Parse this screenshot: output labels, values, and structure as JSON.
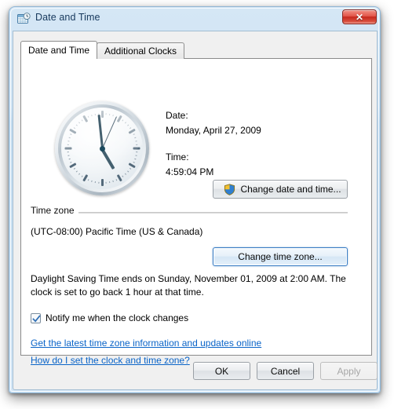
{
  "window": {
    "title": "Date and Time",
    "icon": "date-time-icon",
    "close_label": "✕"
  },
  "tabs": [
    {
      "label": "Date and Time",
      "active": true
    },
    {
      "label": "Additional Clocks",
      "active": false
    }
  ],
  "main": {
    "clock": {
      "icon": "analog-clock",
      "hour_angle": 149.5,
      "minute_angle": 354,
      "second_angle": 24
    },
    "date_label": "Date:",
    "date_value": "Monday, April 27, 2009",
    "time_label": "Time:",
    "time_value": "4:59:04 PM",
    "change_datetime_button": "Change date and time...",
    "timezone_group_label": "Time zone",
    "timezone_value": "(UTC-08:00) Pacific Time (US & Canada)",
    "change_timezone_button": "Change time zone...",
    "dst_text": "Daylight Saving Time ends on Sunday, November 01, 2009 at 2:00 AM. The clock is set to go back 1 hour at that time.",
    "notify_checkbox_label": "Notify me when the clock changes",
    "notify_checkbox_checked": true,
    "link_updates": "Get the latest time zone information and updates online",
    "link_howto": "How do I set the clock and time zone?"
  },
  "footer": {
    "ok": "OK",
    "cancel": "Cancel",
    "apply": "Apply",
    "apply_disabled": true
  },
  "colors": {
    "link": "#0a64c8",
    "frame": "#cfe3f4",
    "title_text": "#16385c",
    "close_button": "#c6281c",
    "focus_border": "#3a7dc4"
  }
}
